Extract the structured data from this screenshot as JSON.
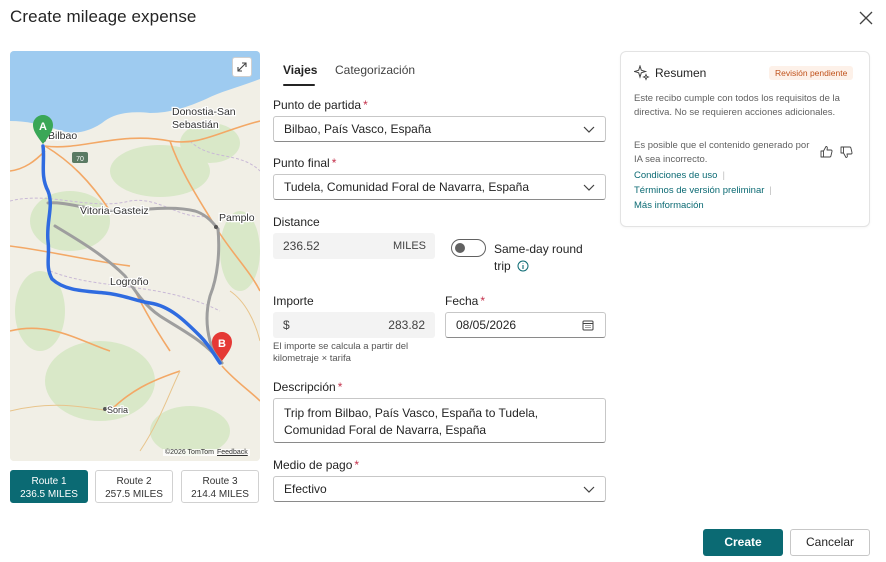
{
  "dialog": {
    "title": "Create mileage expense"
  },
  "map": {
    "places": [
      "Bilbao",
      "Donostia-San",
      "Sebastián",
      "Vitoria-Gasteiz",
      "Pamplo",
      "Logroño",
      "Soria"
    ],
    "road_shield": "70",
    "markers": {
      "start": "A",
      "end": "B"
    },
    "attribution": "©2026 TomTom",
    "feedback": "Feedback"
  },
  "routes": [
    {
      "name": "Route 1",
      "distance": "236.5 MILES",
      "selected": true
    },
    {
      "name": "Route 2",
      "distance": "257.5 MILES",
      "selected": false
    },
    {
      "name": "Route 3",
      "distance": "214.4 MILES",
      "selected": false
    }
  ],
  "tabs": [
    {
      "label": "Viajes",
      "active": true
    },
    {
      "label": "Categorización",
      "active": false
    }
  ],
  "form": {
    "start": {
      "label": "Punto de partida",
      "required": "*",
      "value": "Bilbao, País Vasco, España"
    },
    "end": {
      "label": "Punto final",
      "required": "*",
      "value": "Tudela, Comunidad Foral de Navarra, España"
    },
    "distance": {
      "label": "Distance",
      "value": "236.52",
      "unit": "MILES"
    },
    "round_trip": {
      "label": "Same-day round trip",
      "enabled": false
    },
    "amount": {
      "label": "Importe",
      "currency": "$",
      "value": "283.82",
      "helper": "El importe se calcula a partir del kilometraje × tarifa"
    },
    "date": {
      "label": "Fecha",
      "required": "*",
      "value": "08/05/2026"
    },
    "description": {
      "label": "Descripción",
      "required": "*",
      "value": "Trip from Bilbao, País Vasco, España to Tudela, Comunidad Foral de Navarra, España"
    },
    "payment": {
      "label": "Medio de pago",
      "required": "*",
      "value": "Efectivo"
    }
  },
  "summary": {
    "title": "Resumen",
    "status": "Revisión pendiente",
    "message": "Este recibo cumple con todos los requisitos de la directiva. No se requieren acciones adicionales.",
    "ai_note": "Es posible que el contenido generado por IA sea incorrecto.",
    "links": [
      "Condiciones de uso",
      "Términos de versión preliminar",
      "Más información"
    ]
  },
  "actions": {
    "create": "Create",
    "cancel": "Cancelar"
  },
  "colors": {
    "accent": "#0b6a73",
    "route_main": "#2f6be0",
    "route_alt": "#9e9e9e",
    "marker_start": "#3aa757",
    "marker_end": "#e53935",
    "badge_text": "#c0521b"
  }
}
